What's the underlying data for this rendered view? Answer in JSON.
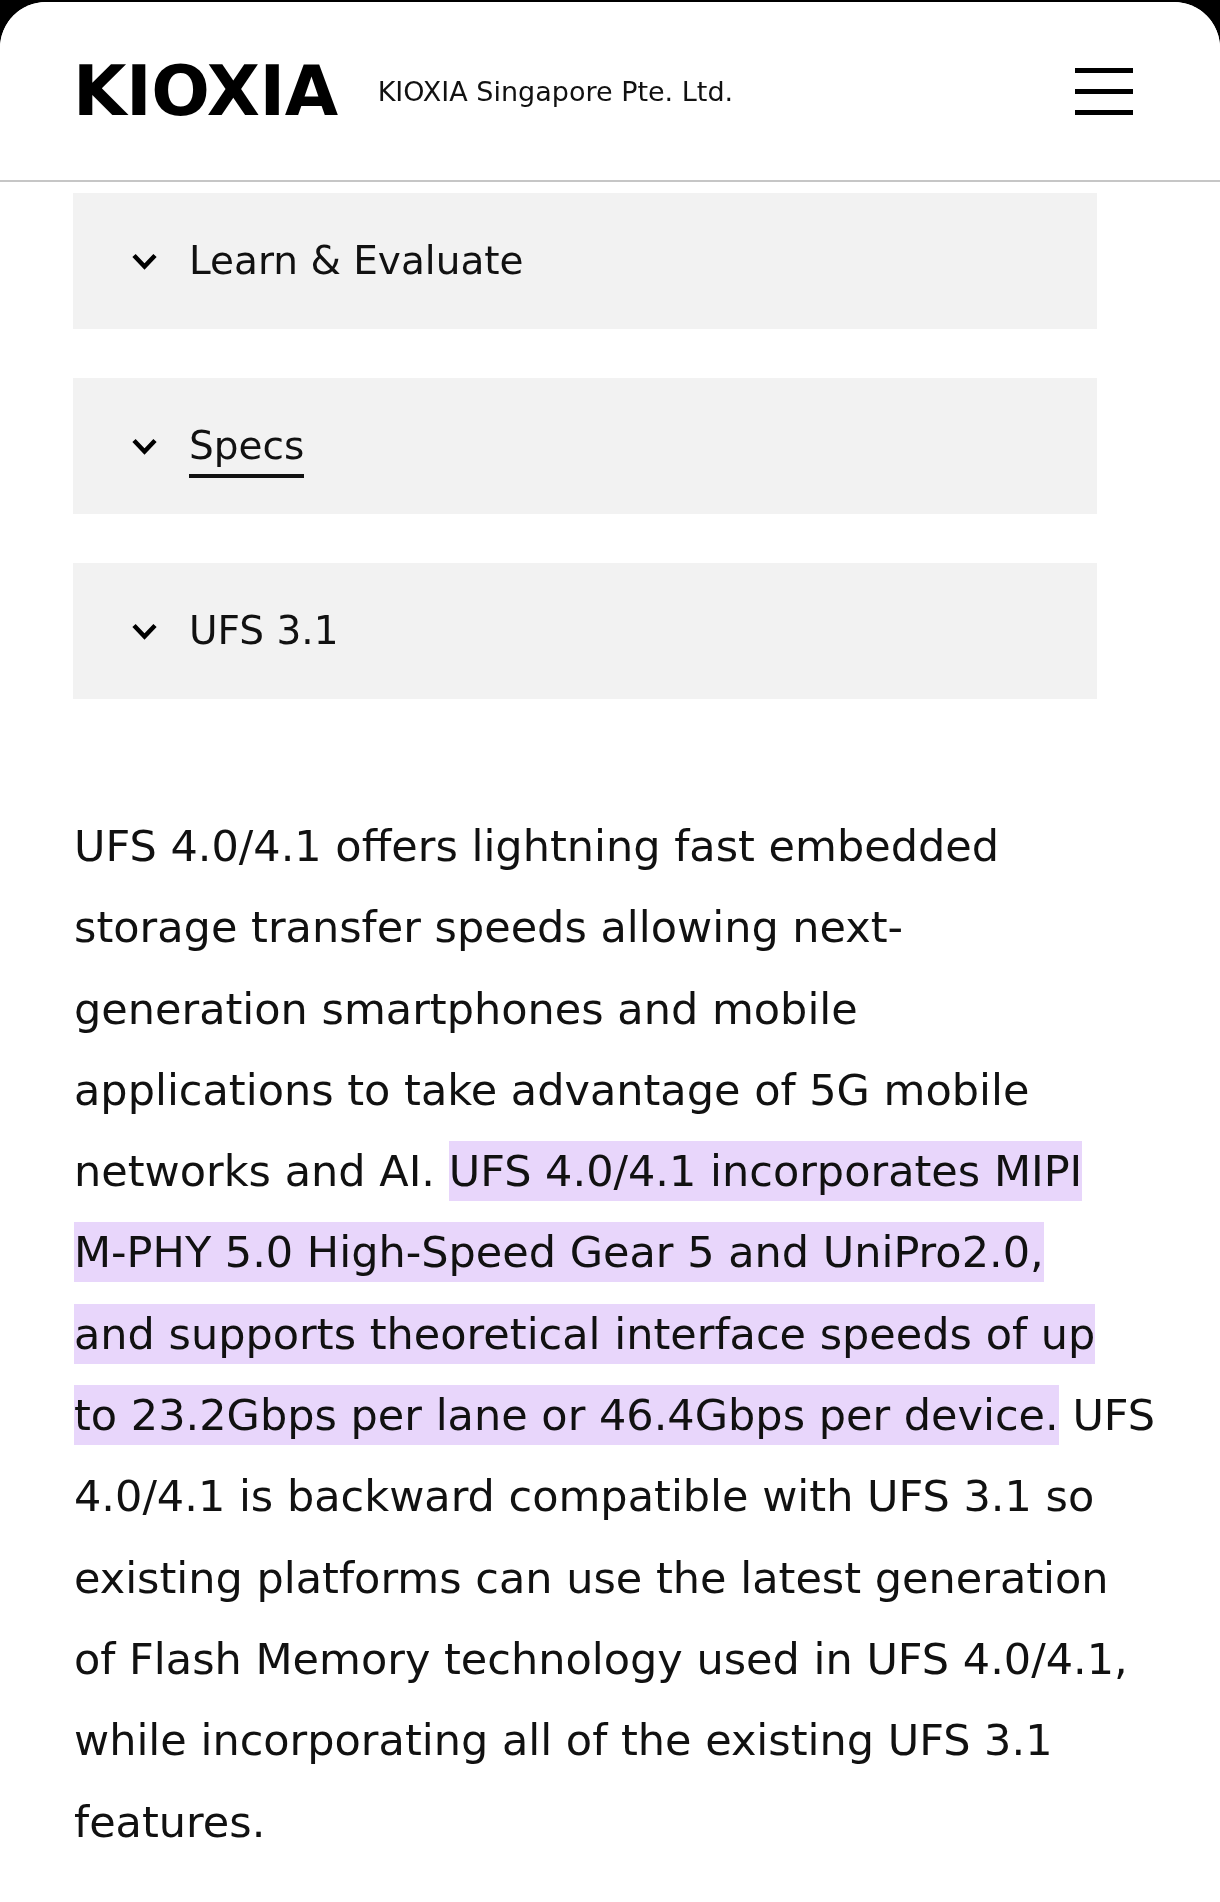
{
  "header": {
    "logo": "KIOXIA",
    "company": "KIOXIA Singapore Pte. Ltd."
  },
  "accordions": [
    {
      "label": "Learn & Evaluate",
      "expanded": false,
      "underlined": false
    },
    {
      "label": "Specs",
      "expanded": false,
      "underlined": true
    },
    {
      "label": "UFS 3.1",
      "expanded": false,
      "underlined": false
    }
  ],
  "paragraph": {
    "segments": [
      {
        "text": "UFS 4.0/4.1 offers lightning fast embedded\nstorage transfer speeds allowing next-\ngeneration smartphones and mobile\napplications to take advantage of 5G mobile\nnetworks and AI.",
        "highlighted": false
      },
      {
        "text": "UFS 4.0/4.1 incorporates MIPI\nM-PHY 5.0 High-Speed Gear 5 and UniPro2.0,\nand supports theoretical interface speeds of up\nto 23.2Gbps per lane or 46.4Gbps per device.",
        "highlighted": true
      },
      {
        "text": "UFS\n4.0/4.1 is backward compatible with UFS 3.1 so\nexisting platforms can use the latest generation\nof Flash Memory technology used in UFS 4.0/4.1,\nwhile incorporating all of the existing UFS 3.1\nfeatures.",
        "highlighted": false
      }
    ]
  }
}
